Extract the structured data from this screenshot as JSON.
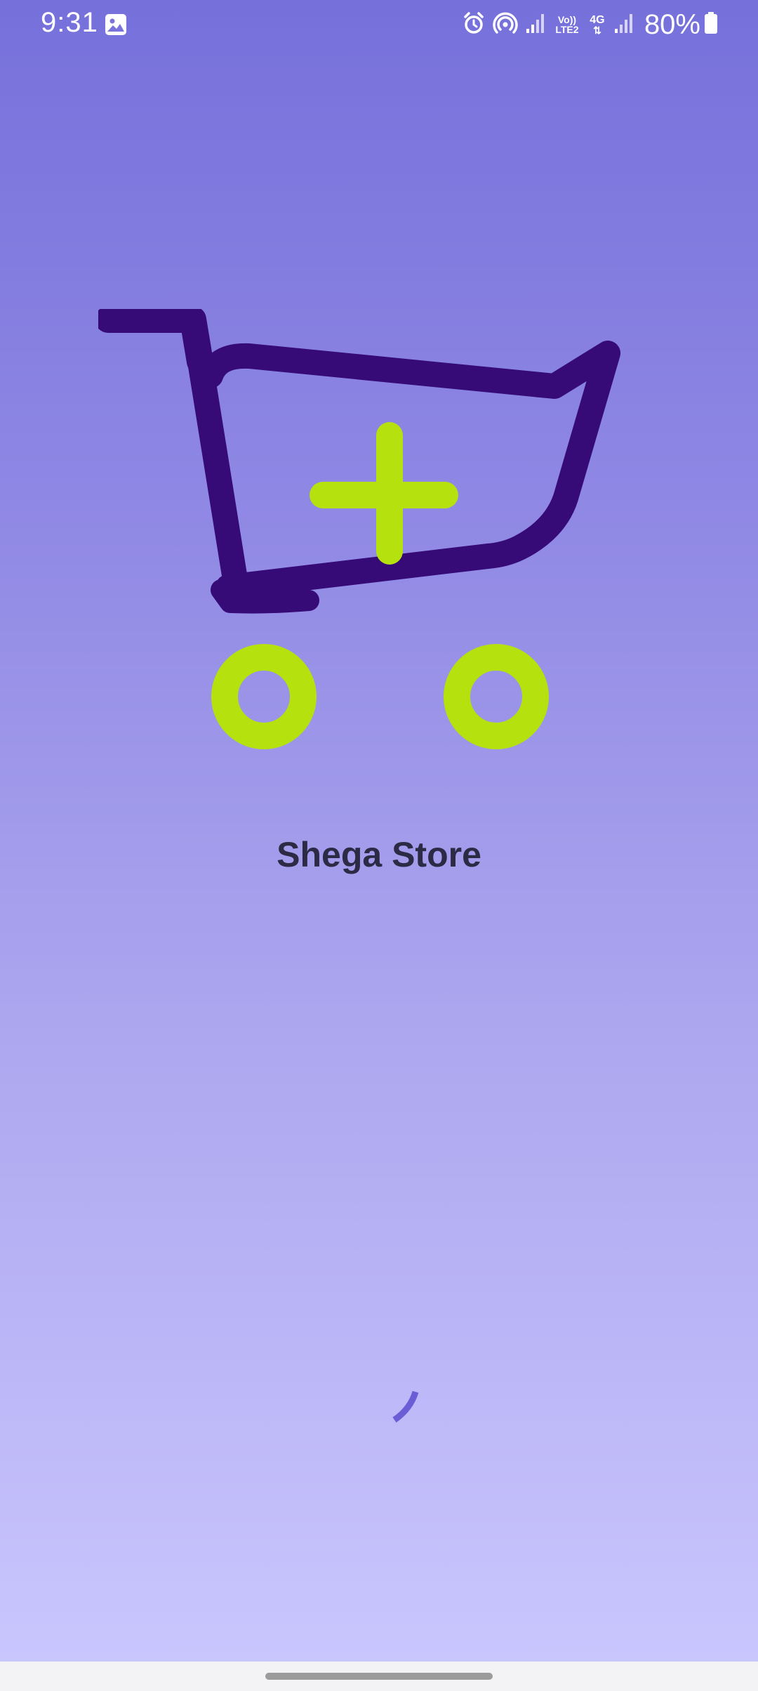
{
  "status_bar": {
    "time": "9:31",
    "battery": "80%",
    "volte_label": "Vo)) LTE2",
    "network_label": "4G",
    "icons": [
      "gallery-icon",
      "alarm-icon",
      "hotspot-icon",
      "signal-icon",
      "volte-icon",
      "data-4g-icon",
      "signal-icon",
      "battery-icon"
    ]
  },
  "splash": {
    "app_name": "Shega Store",
    "logo": "shopping-cart-plus-icon",
    "colors": {
      "cart": "#360a77",
      "accent": "#b5e10e",
      "spinner": "#6a5ed6",
      "background_top": "#7670db",
      "background_bottom": "#c9c5fd"
    }
  }
}
